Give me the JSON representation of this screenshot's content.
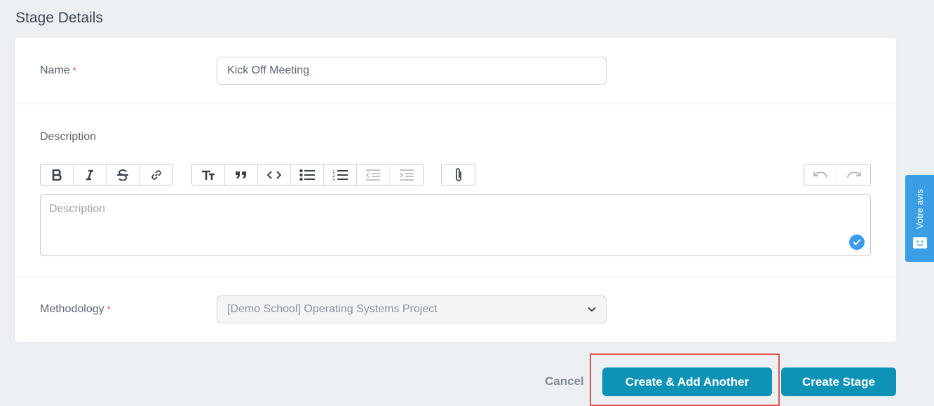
{
  "page": {
    "title": "Stage Details"
  },
  "form": {
    "name_label": "Name",
    "required_mark": "*",
    "name_value": "Kick Off Meeting",
    "description_label": "Description",
    "description_placeholder": "Description",
    "methodology_label": "Methodology",
    "methodology_value": "[Demo School] Operating Systems Project"
  },
  "toolbar": {
    "groups": [
      [
        "bold-icon",
        "italic-icon",
        "strikethrough-icon",
        "link-icon"
      ],
      [
        "heading-icon",
        "quote-icon",
        "code-icon",
        "bullet-list-icon",
        "numbered-list-icon",
        "outdent-icon",
        "indent-icon"
      ],
      [
        "attachment-icon"
      ],
      [
        "undo-icon",
        "redo-icon"
      ]
    ]
  },
  "actions": {
    "cancel_label": "Cancel",
    "create_add_label": "Create & Add Another",
    "create_label": "Create Stage"
  },
  "feedback": {
    "label": "Votre avis"
  },
  "colors": {
    "primary": "#0e93b6",
    "highlight": "#e35252",
    "feedback": "#3a9ee4",
    "required": "#e04848"
  }
}
